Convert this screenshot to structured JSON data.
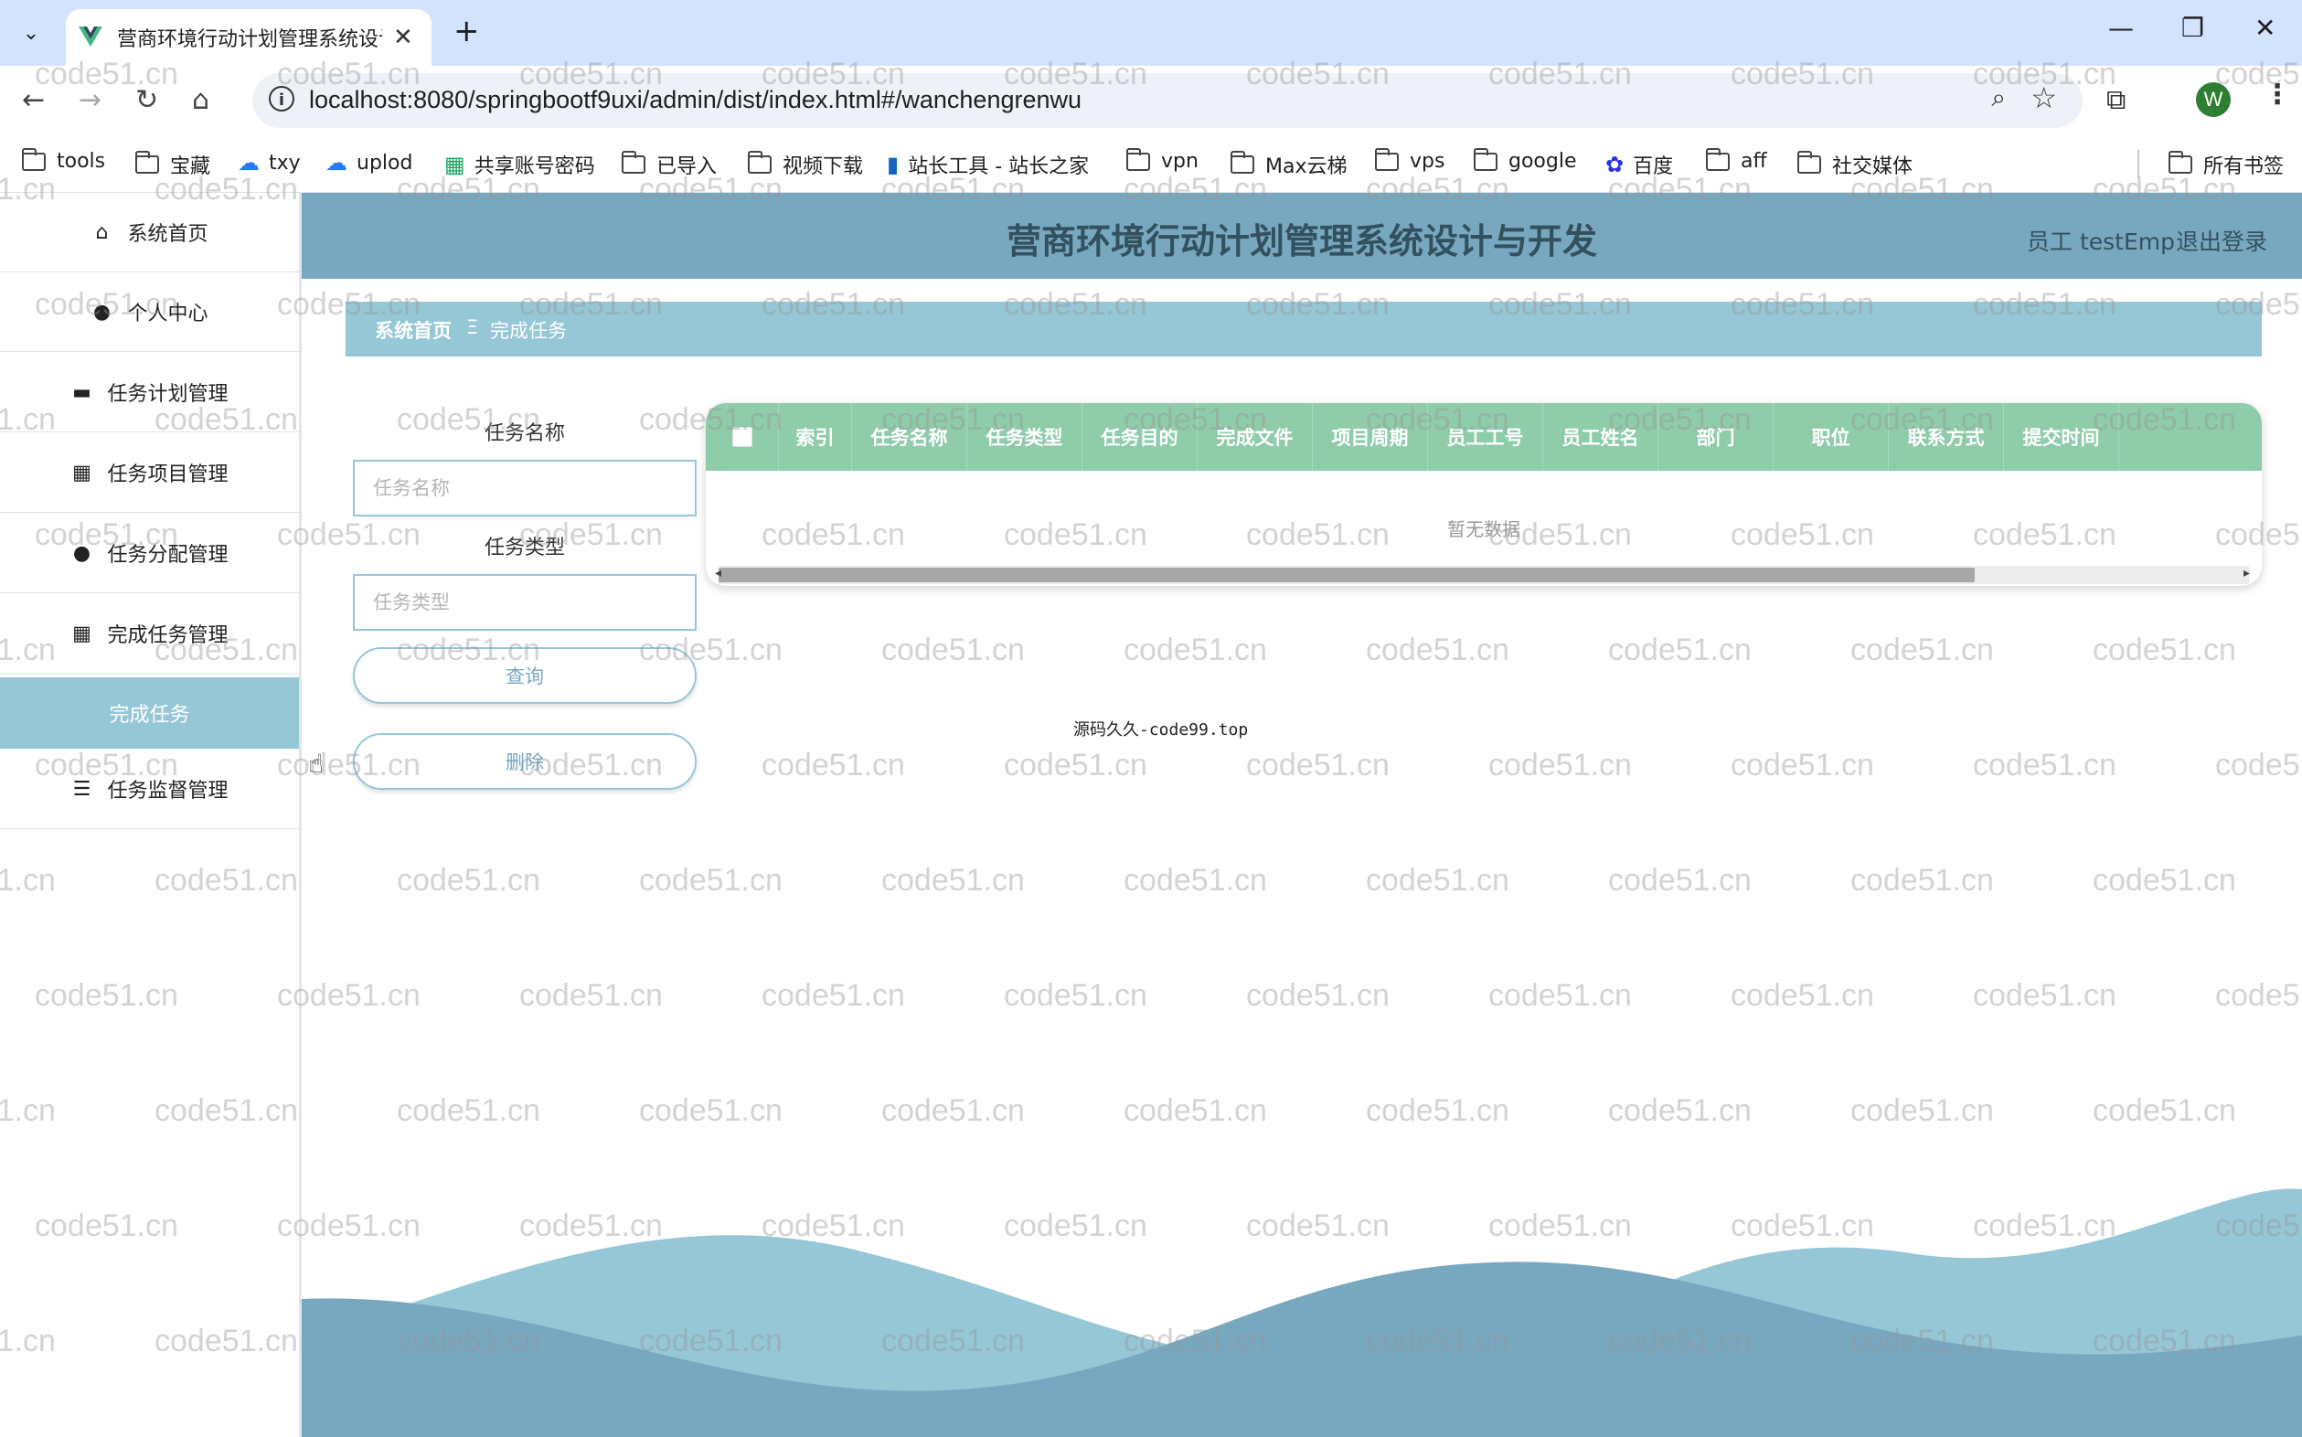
{
  "browser": {
    "tab_title": "营商环境行动计划管理系统设计",
    "url": "localhost:8080/springbootf9uxi/admin/dist/index.html#/wanchengrenwu",
    "avatar_letter": "W",
    "bookmarks": [
      {
        "label": "tools",
        "icon": "folder-icon"
      },
      {
        "label": "宝藏",
        "icon": "folder-icon"
      },
      {
        "label": "txy",
        "icon": "cloud-icon"
      },
      {
        "label": "uplod",
        "icon": "cloud-icon"
      },
      {
        "label": "共享账号密码",
        "icon": "sheet-icon"
      },
      {
        "label": "已导入",
        "icon": "folder-icon"
      },
      {
        "label": "视频下载",
        "icon": "folder-icon"
      },
      {
        "label": "站长工具 - 站长之家",
        "icon": "site-icon"
      },
      {
        "label": "vpn",
        "icon": "folder-icon"
      },
      {
        "label": "Max云梯",
        "icon": "folder-icon"
      },
      {
        "label": "vps",
        "icon": "folder-icon"
      },
      {
        "label": "google",
        "icon": "folder-icon"
      },
      {
        "label": "百度",
        "icon": "baidu-icon"
      },
      {
        "label": "aff",
        "icon": "folder-icon"
      },
      {
        "label": "社交媒体",
        "icon": "folder-icon"
      }
    ],
    "all_bookmarks": "所有书签"
  },
  "sidebar": {
    "items": [
      {
        "label": "系统首页",
        "icon": "home-icon"
      },
      {
        "label": "个人中心",
        "icon": "user-icon"
      },
      {
        "label": "任务计划管理",
        "icon": "monitor-icon"
      },
      {
        "label": "任务项目管理",
        "icon": "grid-icon"
      },
      {
        "label": "任务分配管理",
        "icon": "user-icon"
      },
      {
        "label": "完成任务管理",
        "icon": "grid-icon"
      },
      {
        "label": "任务监督管理",
        "icon": "sliders-icon"
      }
    ],
    "active_submenu": "完成任务"
  },
  "header": {
    "title": "营商环境行动计划管理系统设计与开发",
    "user": "员工 testEmp",
    "logout": "退出登录"
  },
  "breadcrumb": {
    "home": "系统首页",
    "separator": "Ξ",
    "current": "完成任务"
  },
  "search": {
    "name_label": "任务名称",
    "name_placeholder": "任务名称",
    "type_label": "任务类型",
    "type_placeholder": "任务类型",
    "query_button": "查询",
    "delete_button": "删除"
  },
  "table": {
    "columns": [
      "索引",
      "任务名称",
      "任务类型",
      "任务目的",
      "完成文件",
      "项目周期",
      "员工工号",
      "员工姓名",
      "部门",
      "职位",
      "联系方式",
      "提交时间"
    ],
    "empty_text": "暂无数据"
  },
  "source_text": "源码久久-code99.top",
  "watermark_text": "code51.cn",
  "colors": {
    "header": "#78a8c0",
    "breadcrumb": "#95c7d6",
    "table_header": "#8fccaa",
    "active_menu": "#95c7d6"
  }
}
